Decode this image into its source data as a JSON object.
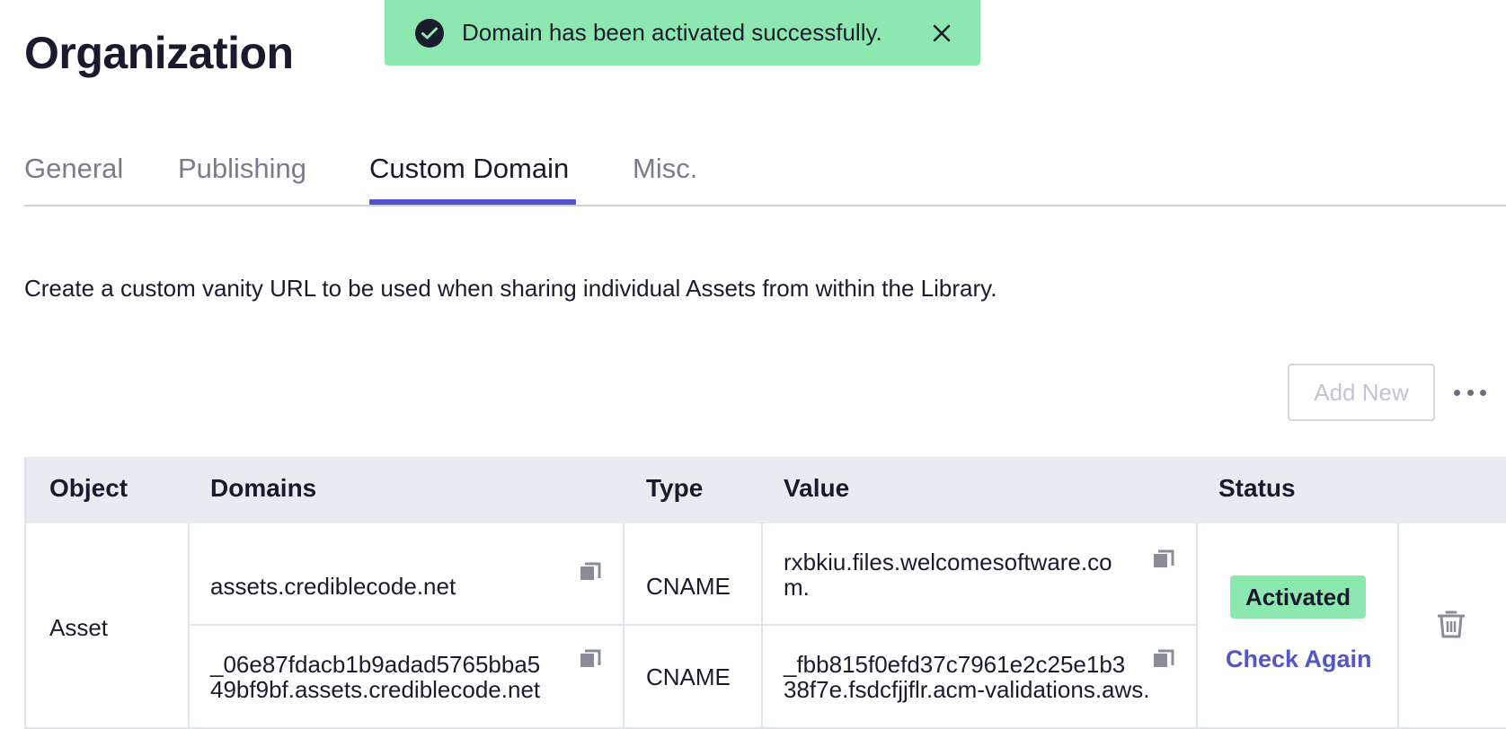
{
  "page": {
    "title": "Organization"
  },
  "toast": {
    "message": "Domain has been activated successfully.",
    "icon": "check-circle-icon",
    "close_icon": "close-icon",
    "color": "#8de8b0"
  },
  "tabs": [
    {
      "label": "General",
      "active": false
    },
    {
      "label": "Publishing",
      "active": false
    },
    {
      "label": "Custom Domain",
      "active": true
    },
    {
      "label": "Misc.",
      "active": false
    }
  ],
  "description": "Create a custom vanity URL to be used when sharing individual Assets from within the Library.",
  "toolbar": {
    "add_new_label": "Add New",
    "add_new_disabled": true,
    "more_icon": "more-horizontal-icon"
  },
  "table": {
    "headers": {
      "object": "Object",
      "domains": "Domains",
      "type": "Type",
      "value": "Value",
      "status": "Status"
    },
    "rows": [
      {
        "object": "Asset",
        "records": [
          {
            "domain": "assets.crediblecode.net",
            "type": "CNAME",
            "value_line1": "rxbkiu.files.welcomesoftware.co",
            "value_line2": "m."
          },
          {
            "domain_line1": "_06e87fdacb1b9adad5765bba5",
            "domain_line2": "49bf9bf.assets.crediblecode.net",
            "type": "CNAME",
            "value_line1": "_fbb815f0efd37c7961e2c25e1b3",
            "value_line2": "38f7e.fsdcfjjflr.acm-validations.aws."
          }
        ],
        "status": "Activated",
        "status_color": "#8de8b0",
        "check_again_label": "Check Again",
        "delete_icon": "trash-icon"
      }
    ]
  },
  "colors": {
    "accent": "#4f55c9",
    "link": "#5257c4",
    "success": "#8de8b0"
  }
}
